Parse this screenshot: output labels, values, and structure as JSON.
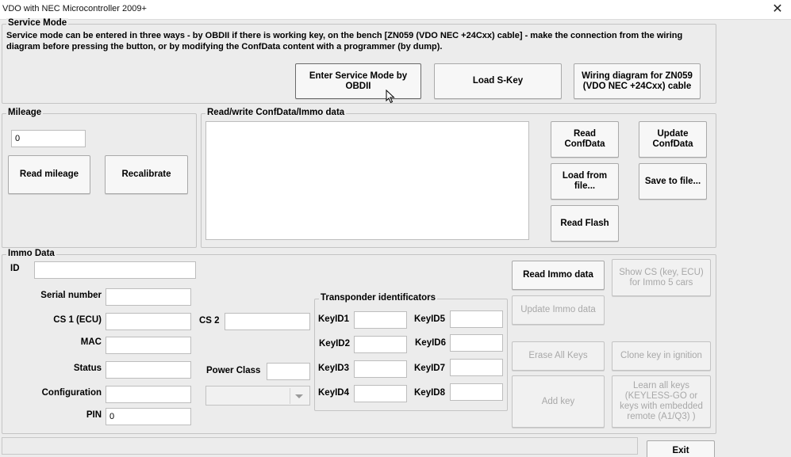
{
  "window": {
    "title": "VDO with NEC Microcontroller 2009+",
    "close_glyph": "✕"
  },
  "service_mode": {
    "legend": "Service Mode",
    "description": "Service mode can be entered in three ways - by OBDII if there is working key, on the bench [ZN059 (VDO NEC +24Cxx) cable] - make the connection from the wiring diagram before pressing the button, or by modifying the ConfData content with a programmer (by dump).",
    "enter_button": "Enter Service Mode by OBDII",
    "load_skey_button": "Load S-Key",
    "wiring_button": "Wiring diagram for ZN059 (VDO NEC +24Cxx) cable"
  },
  "mileage": {
    "legend": "Mileage",
    "value": "0",
    "read_button": "Read mileage",
    "recalibrate_button": "Recalibrate"
  },
  "confdata": {
    "legend": "Read/write ConfData/Immo data",
    "content": "",
    "read_button": "Read ConfData",
    "update_button": "Update ConfData",
    "load_button": "Load from file...",
    "save_button": "Save to file...",
    "read_flash_button": "Read Flash"
  },
  "immo": {
    "legend": "Immo Data",
    "id_label": "ID",
    "id_value": "",
    "serial_label": "Serial number",
    "serial_value": "",
    "cs1_label": "CS 1 (ECU)",
    "cs1_value": "",
    "cs2_label": "CS 2",
    "cs2_value": "",
    "mac_label": "MAC",
    "mac_value": "",
    "status_label": "Status",
    "status_value": "",
    "configuration_label": "Configuration",
    "configuration_value": "",
    "pin_label": "PIN",
    "pin_value": "0",
    "power_class_label": "Power Class",
    "power_class_value": "",
    "power_class_select": ""
  },
  "transponder": {
    "legend": "Transponder identificators",
    "keys": [
      {
        "label": "KeyID1",
        "value": ""
      },
      {
        "label": "KeyID2",
        "value": ""
      },
      {
        "label": "KeyID3",
        "value": ""
      },
      {
        "label": "KeyID4",
        "value": ""
      },
      {
        "label": "KeyID5",
        "value": ""
      },
      {
        "label": "KeyID6",
        "value": ""
      },
      {
        "label": "KeyID7",
        "value": ""
      },
      {
        "label": "KeyID8",
        "value": ""
      }
    ]
  },
  "immo_actions": {
    "read_immo": "Read Immo data",
    "show_cs": "Show CS (key, ECU) for Immo 5 cars",
    "update_immo": "Update Immo data",
    "erase_keys": "Erase All Keys",
    "clone_key": "Clone key in ignition",
    "add_key": "Add key",
    "learn_keys": "Learn all keys (KEYLESS-GO or keys with embedded remote (A1/Q3) )"
  },
  "footer": {
    "exit_button": "Exit",
    "status_text": ""
  }
}
